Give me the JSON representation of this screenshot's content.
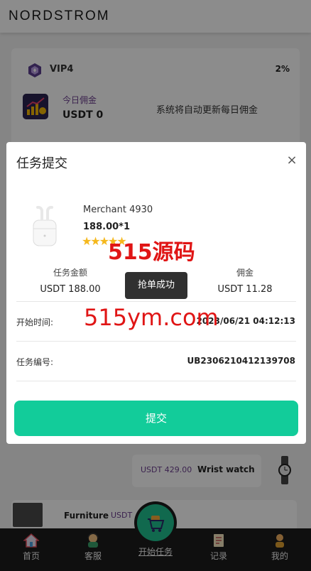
{
  "header": {
    "brand": "NORDSTROM"
  },
  "vip": {
    "level": "VIP4",
    "percent": "2%",
    "today_label": "今日佣金",
    "today_value": "USDT 0",
    "auto_note": "系统将自动更新每日佣金"
  },
  "orders": [
    {
      "price": "USDT 429.00",
      "name": "Wrist watch",
      "icon": "watch-icon"
    },
    {
      "price": "USDT",
      "name": "Furniture",
      "icon": "furniture-icon"
    }
  ],
  "tabbar": {
    "items": [
      {
        "label": "首页",
        "icon": "home-icon"
      },
      {
        "label": "客服",
        "icon": "customer-service-icon"
      },
      {
        "label": "开始任务",
        "icon": "cart-icon"
      },
      {
        "label": "记录",
        "icon": "record-icon"
      },
      {
        "label": "我的",
        "icon": "user-icon"
      }
    ]
  },
  "modal": {
    "title": "任务提交",
    "close": "×",
    "merchant": "Merchant 4930",
    "price_qty": "188.00*1",
    "rating": 5,
    "stars": "★★★★★",
    "amount_label": "任务金额",
    "amount_value": "USDT 188.00",
    "commission_label": "佣金",
    "commission_value": "USDT 11.28",
    "start_time_label": "开始时间:",
    "start_time_value": "2023/06/21 04:12:13",
    "task_no_label": "任务编号:",
    "task_no_value": "UB2306210412139708",
    "submit_label": "提交"
  },
  "toast": {
    "text": "抢单成功"
  },
  "watermark": {
    "line1": "515源码",
    "line2": "515ym.com"
  },
  "colors": {
    "accent": "#12cc9a",
    "watermark": "#e01515",
    "purple_text": "#6c3f8f"
  }
}
